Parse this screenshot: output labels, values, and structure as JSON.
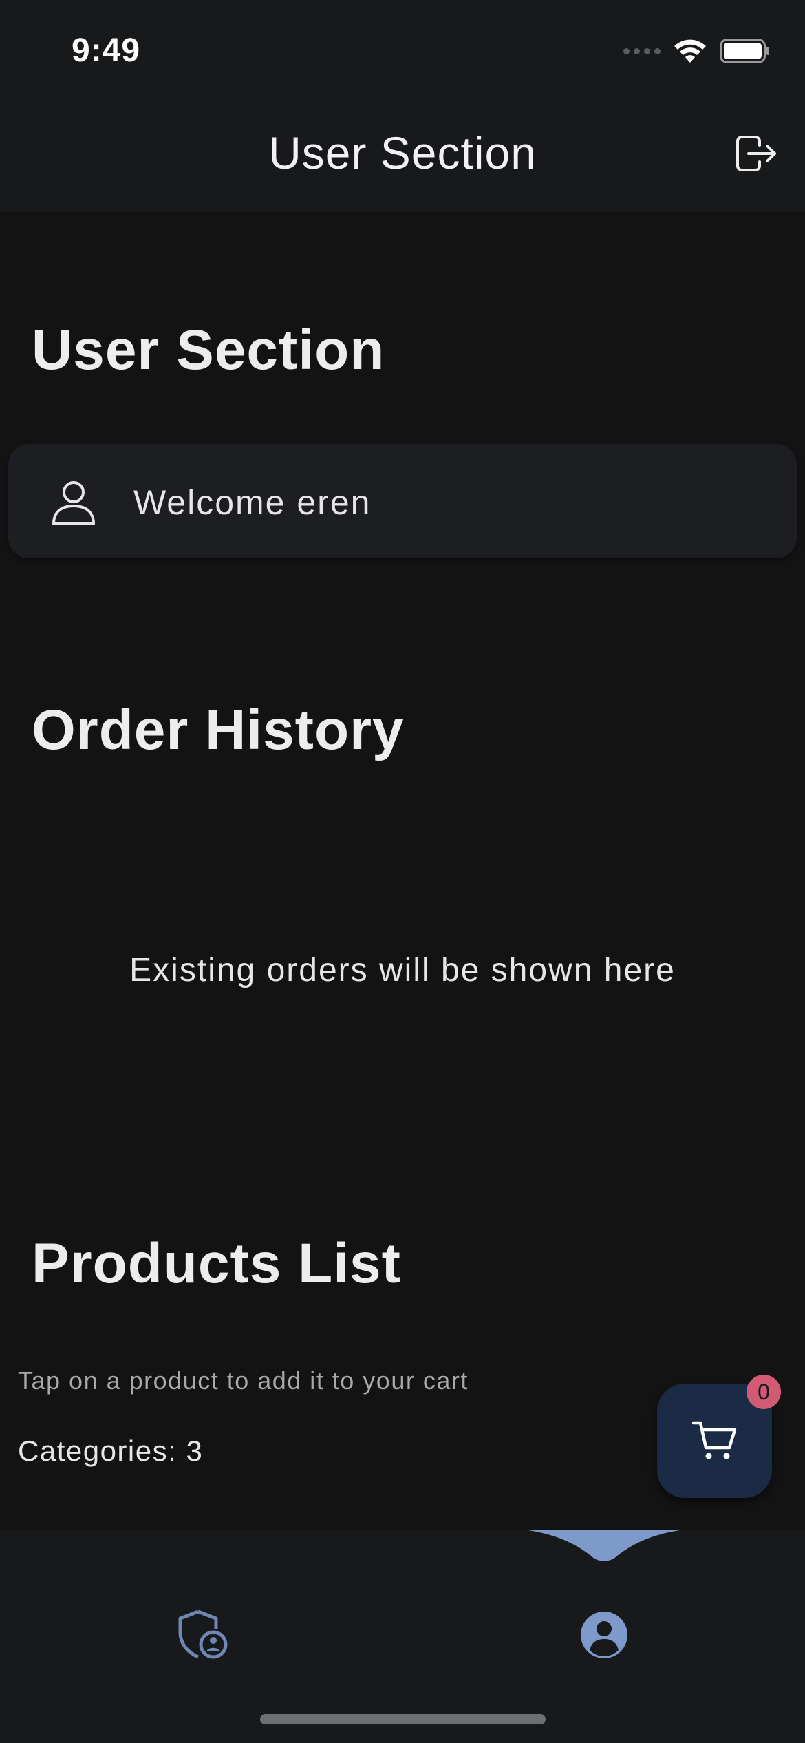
{
  "status_bar": {
    "time": "9:49",
    "icons": [
      "cellular-signal-icon",
      "wifi-icon",
      "battery-icon"
    ]
  },
  "app_bar": {
    "title": "User Section",
    "action_icon": "logout-icon"
  },
  "sections": {
    "user": {
      "heading": "User Section",
      "welcome_icon": "person-outline-icon",
      "welcome_text": "Welcome eren"
    },
    "orders": {
      "heading": "Order History",
      "empty_message": "Existing orders will be shown here"
    },
    "products": {
      "heading": "Products List",
      "hint": "Tap on a product to add it to your cart",
      "categories_label": "Categories: 3"
    }
  },
  "cart_fab": {
    "icon": "cart-icon",
    "badge_count": "0"
  },
  "bottom_nav": {
    "items": [
      {
        "icon": "admin-shield-icon",
        "selected": false
      },
      {
        "icon": "account-circle-icon",
        "selected": true
      }
    ]
  },
  "colors": {
    "background": "#131314",
    "surface": "#18191b",
    "card": "#1d1e21",
    "accent": "#7e9acb",
    "fab": "#1b2a45",
    "badge": "#d25a74"
  }
}
